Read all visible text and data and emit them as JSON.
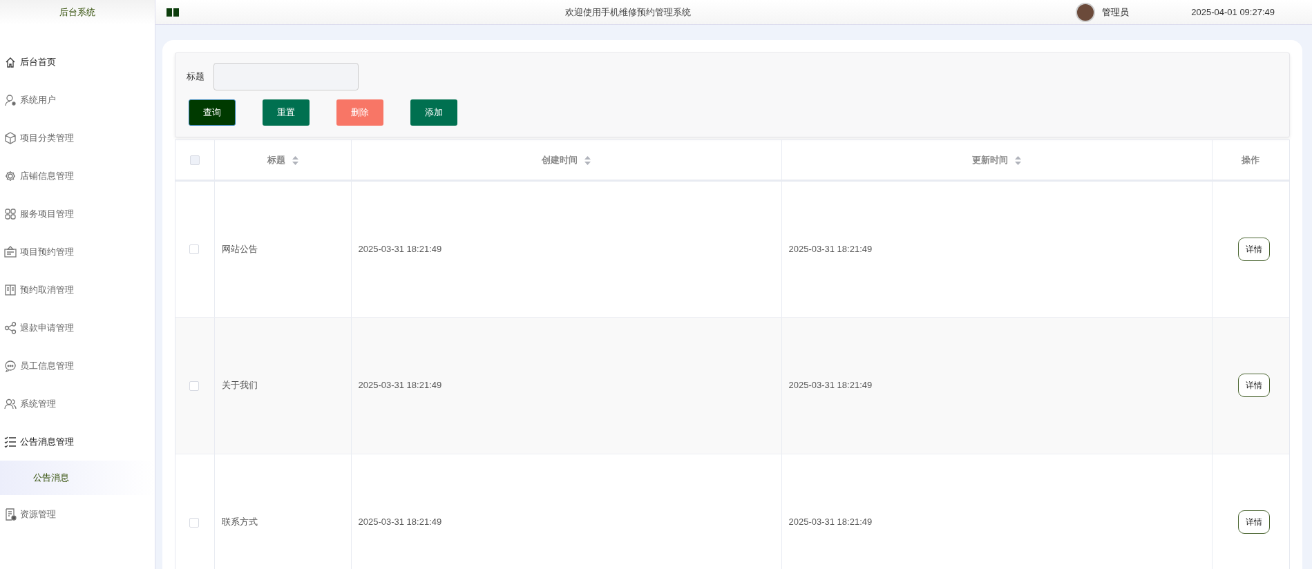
{
  "sidebar": {
    "title": "后台系统",
    "items": [
      {
        "label": "后台首页",
        "selected": false,
        "active": true
      },
      {
        "label": "系统用户",
        "selected": false,
        "active": false
      },
      {
        "label": "项目分类管理",
        "selected": false,
        "active": false
      },
      {
        "label": "店铺信息管理",
        "selected": false,
        "active": false
      },
      {
        "label": "服务项目管理",
        "selected": false,
        "active": false
      },
      {
        "label": "项目预约管理",
        "selected": false,
        "active": false
      },
      {
        "label": "预约取消管理",
        "selected": false,
        "active": false
      },
      {
        "label": "退款申请管理",
        "selected": false,
        "active": false
      },
      {
        "label": "员工信息管理",
        "selected": false,
        "active": false
      },
      {
        "label": "系统管理",
        "selected": false,
        "active": false
      },
      {
        "label": "公告消息管理",
        "selected": false,
        "active": true,
        "expanded": true,
        "children": [
          {
            "label": "公告消息",
            "selected": true
          }
        ]
      },
      {
        "label": "资源管理",
        "selected": false,
        "active": false
      }
    ]
  },
  "header": {
    "welcome": "欢迎使用手机维修预约管理系统",
    "user": "管理员",
    "datetime": "2025-04-01 09:27:49"
  },
  "search": {
    "label": "标题"
  },
  "buttons": [
    {
      "label": "查询",
      "color": "#003a00"
    },
    {
      "label": "重置",
      "color": "#007050"
    },
    {
      "label": "删除",
      "color": "#f87666"
    },
    {
      "label": "添加",
      "color": "#007050"
    }
  ],
  "table": {
    "select_all": {
      "checked": false
    },
    "columns": [
      {
        "label": "标题",
        "sortable": true
      },
      {
        "label": "创建时间",
        "sortable": true
      },
      {
        "label": "更新时间",
        "sortable": true
      },
      {
        "label": "操作",
        "sortable": false
      }
    ],
    "rows": [
      {
        "checked": false,
        "cells": [
          "网站公告",
          "2025-03-31 18:21:49",
          "2025-03-31 18:21:49"
        ],
        "action": "详情"
      },
      {
        "checked": false,
        "cells": [
          "关于我们",
          "2025-03-31 18:21:49",
          "2025-03-31 18:21:49"
        ],
        "action": "详情"
      },
      {
        "checked": false,
        "cells": [
          "联系方式",
          "2025-03-31 18:21:49",
          "2025-03-31 18:21:49"
        ],
        "action": "详情"
      }
    ]
  }
}
